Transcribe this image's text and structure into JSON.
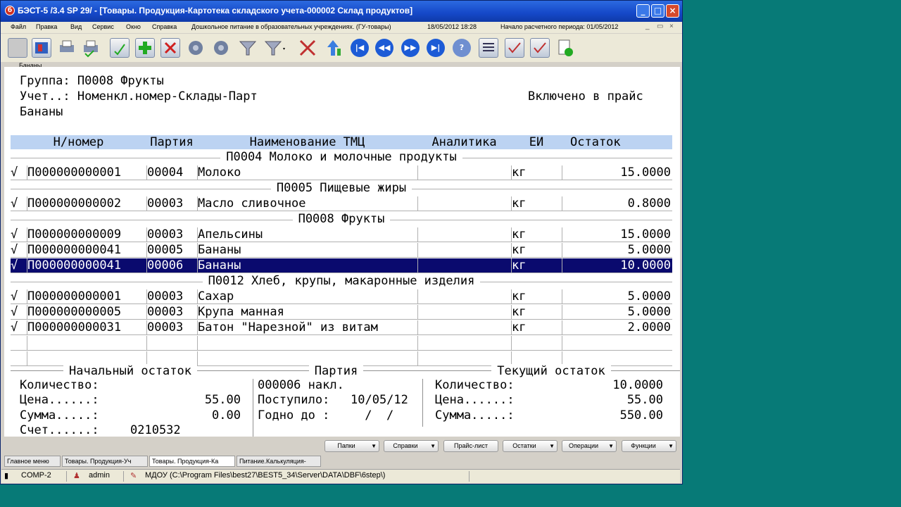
{
  "window": {
    "title": "БЭСТ-5 /3.4 SP 29/ - [Товары. Продукция-Картотека складского учета-000002  Склад продуктов]",
    "controls": [
      "_",
      "□",
      "×"
    ]
  },
  "menu": {
    "items": [
      "Файл",
      "Правка",
      "Вид",
      "Сервис",
      "Окно",
      "Справка",
      "Дошкольное питание в образовательных учреждениях. (ГУ-товары)"
    ],
    "date": "18/05/2012 18:28",
    "period": "Начало расчетного периода: 01/05/2012",
    "mdi_controls": [
      "_",
      "▭",
      "×"
    ]
  },
  "toolbar": {
    "icons": [
      "record-icon",
      "book-icon",
      "printer-icon",
      "printer2-icon",
      "edit-icon",
      "add-icon",
      "delete-icon",
      "sort-icon",
      "sort2-icon",
      "filter-icon",
      "filter-dropdown-icon",
      "clear-filter-icon",
      "chart-icon",
      "first-icon",
      "prev-icon",
      "next-icon",
      "last-icon",
      "help-icon",
      "list-icon",
      "check-icon",
      "check2-icon",
      "doc-check-icon"
    ],
    "tooltip": "Бананы"
  },
  "header": {
    "group_line": "Группа: П0008 Фрукты",
    "account_line": "Учет..: Номенкл.номер-Склады-Парт",
    "price_flag": "Включено в прайс",
    "item_name": "Бананы"
  },
  "table": {
    "columns": [
      "Н/номер",
      "Партия",
      "Наименование ТМЦ",
      "Аналитика",
      "ЕИ",
      "Остаток"
    ],
    "groups": [
      {
        "title": "П0004 Молоко и молочные продукты",
        "rows": [
          {
            "check": "√",
            "num": "П000000000001",
            "batch": "00004",
            "name": "Молоко",
            "analytic": "",
            "unit": "кг",
            "rest": "15.0000"
          }
        ]
      },
      {
        "title": "П0005 Пищевые жиры",
        "rows": [
          {
            "check": "√",
            "num": "П000000000002",
            "batch": "00003",
            "name": "Масло сливочное",
            "analytic": "",
            "unit": "кг",
            "rest": "0.8000"
          }
        ]
      },
      {
        "title": "П0008 Фрукты",
        "rows": [
          {
            "check": "√",
            "num": "П000000000009",
            "batch": "00003",
            "name": "Апельсины",
            "analytic": "",
            "unit": "кг",
            "rest": "15.0000"
          },
          {
            "check": "√",
            "num": "П000000000041",
            "batch": "00005",
            "name": "Бананы",
            "analytic": "",
            "unit": "кг",
            "rest": "5.0000"
          },
          {
            "check": "√",
            "num": "П000000000041",
            "batch": "00006",
            "name": "Бананы",
            "analytic": "",
            "unit": "кг",
            "rest": "10.0000"
          }
        ]
      },
      {
        "title": "П0012 Хлеб, крупы, макаронные изделия",
        "rows": [
          {
            "check": "√",
            "num": "П000000000001",
            "batch": "00003",
            "name": "Сахар",
            "analytic": "",
            "unit": "кг",
            "rest": "5.0000"
          },
          {
            "check": "√",
            "num": "П000000000005",
            "batch": "00003",
            "name": "Крупа манная",
            "analytic": "",
            "unit": "кг",
            "rest": "5.0000"
          },
          {
            "check": "√",
            "num": "П000000000031",
            "batch": "00003",
            "name": "Батон \"Нарезной\" из витам",
            "analytic": "",
            "unit": "кг",
            "rest": "2.0000"
          }
        ]
      }
    ]
  },
  "footer": {
    "initial": {
      "title": "Начальный остаток",
      "qty_label": "Количество:",
      "qty": "",
      "price_label": "Цена......:",
      "price": "55.00",
      "sum_label": "Сумма.....:",
      "sum": "0.00",
      "account_label": "Счет......:",
      "account": "0210532"
    },
    "batch": {
      "title": "Партия",
      "doc": "000006 накл.",
      "received_label": "Поступило:",
      "received": "10/05/12",
      "valid_label": "Годно до :",
      "valid": " /  /"
    },
    "current": {
      "title": "Текущий остаток",
      "qty_label": "Количество:",
      "qty": "10.0000",
      "price_label": "Цена......:",
      "price": "55.00",
      "sum_label": "Сумма.....:",
      "sum": "550.00"
    }
  },
  "buttons": [
    {
      "label": "Папки",
      "dropdown": true
    },
    {
      "label": "Справки",
      "dropdown": true
    },
    {
      "label": "Прайс-лист",
      "dropdown": false
    },
    {
      "label": "Остатки",
      "dropdown": true
    },
    {
      "label": "Операции",
      "dropdown": true
    },
    {
      "label": "Функции",
      "dropdown": true
    }
  ],
  "tabs": [
    "Главное меню",
    "Товары. Продукция-Уч",
    "Товары. Продукция-Ка",
    "Питание.Калькуляция-"
  ],
  "status": {
    "computer": "COMP-2",
    "user": "admin",
    "database": "МДОУ (C:\\Program Files\\best27\\BEST5_34\\Server\\DATA\\DBF\\6step\\)"
  },
  "colors": {
    "desktop": "#077a77",
    "selection": "#0a0a6e",
    "header_bg": "#bcd3f2",
    "titlebar": "#1548c8"
  }
}
